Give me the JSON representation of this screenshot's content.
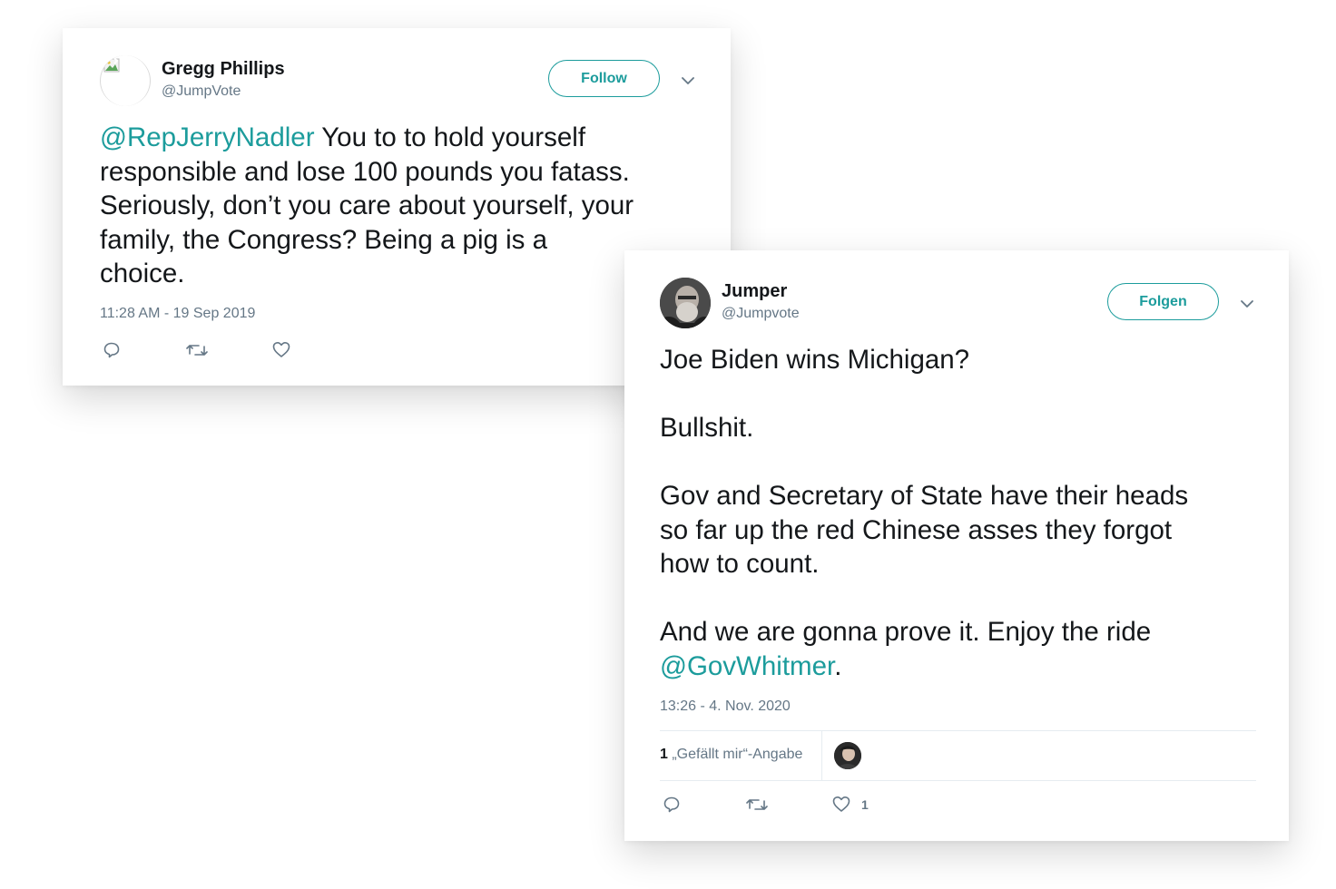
{
  "tweet1": {
    "name": "Gregg Phillips",
    "handle": "@JumpVote",
    "follow_label": "Follow",
    "mention": "@RepJerryNadler",
    "text_line1_rest": " You to to hold yourself",
    "text_line2": "responsible and lose 100 pounds you fatass.",
    "text_line3": "Seriously, don’t you care about yourself, your",
    "text_line4": "family, the Congress? Being a pig is a",
    "text_line5": "choice.",
    "timestamp": "11:28 AM - 19 Sep 2019",
    "icons": [
      "reply-icon",
      "retweet-icon",
      "like-icon",
      "chevron-down-icon",
      "broken-image-icon"
    ]
  },
  "tweet2": {
    "name": "Jumper",
    "handle": "@Jumpvote",
    "follow_label": "Folgen",
    "para1": "Joe Biden wins Michigan?",
    "para2": "Bullshit.",
    "para3_line1": "Gov and Secretary of State have their heads",
    "para3_line2": "so far up the red Chinese asses they forgot",
    "para3_line3": "how to count.",
    "para4_line1": "And we are gonna prove it. Enjoy the ride",
    "mention": "@GovWhitmer",
    "para4_end": ".",
    "timestamp": "13:26 - 4. Nov. 2020",
    "likes_count": "1",
    "likes_label": " „Gefällt mir“-Angabe",
    "like_action_count": "1",
    "icons": [
      "reply-icon",
      "retweet-icon",
      "like-icon",
      "chevron-down-icon",
      "avatar"
    ]
  },
  "colors": {
    "accent": "#1c9c9c",
    "secondary_text": "#657786",
    "primary_text": "#14171a",
    "divider": "#e6ecf0"
  }
}
